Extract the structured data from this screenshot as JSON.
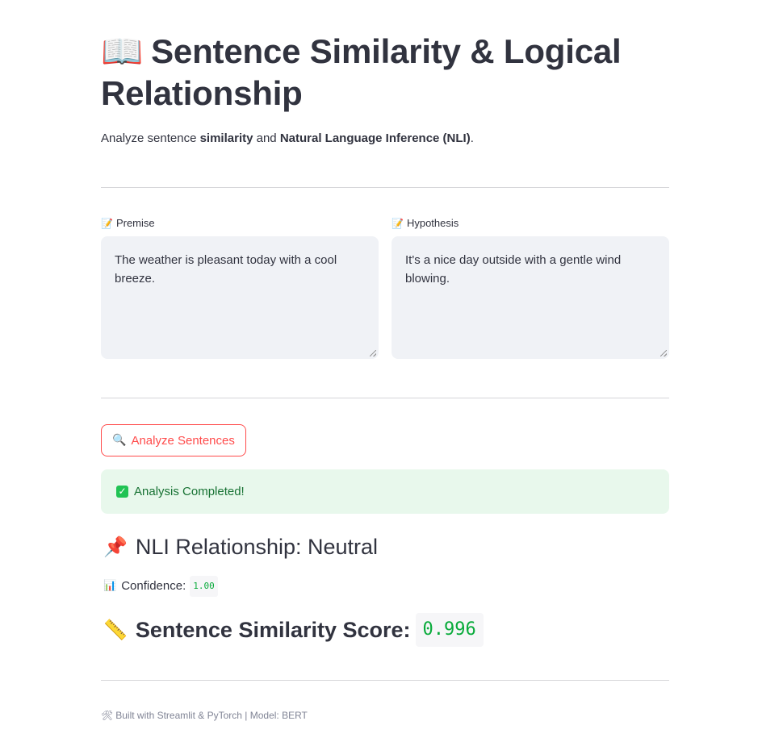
{
  "header": {
    "title_icon": "📖",
    "title": "Sentence Similarity & Logical Relationship",
    "subtitle_prefix": "Analyze sentence ",
    "subtitle_bold1": "similarity",
    "subtitle_mid": " and ",
    "subtitle_bold2": "Natural Language Inference (NLI)",
    "subtitle_suffix": "."
  },
  "inputs": {
    "premise": {
      "icon": "memo-icon",
      "label": "Premise",
      "value": "The weather is pleasant today with a cool breeze."
    },
    "hypothesis": {
      "icon": "memo-icon",
      "label": "Hypothesis",
      "value": "It's a nice day outside with a gentle wind blowing."
    }
  },
  "actions": {
    "analyze_label": "Analyze Sentences",
    "analyze_icon": "magnifier-icon"
  },
  "status": {
    "success_text": "Analysis Completed!"
  },
  "results": {
    "nli_label": "NLI Relationship: Neutral",
    "confidence_label": "Confidence:",
    "confidence_value": "1.00",
    "similarity_label": "Sentence Similarity Score:",
    "similarity_value": "0.996"
  },
  "footer": {
    "text": "Built with Streamlit & PyTorch | Model: BERT"
  },
  "colors": {
    "accent": "#ff4b4b",
    "success_bg": "#e8f8ec",
    "success_text": "#177233",
    "code_green": "#09ab3b",
    "input_bg": "#f0f2f6"
  }
}
